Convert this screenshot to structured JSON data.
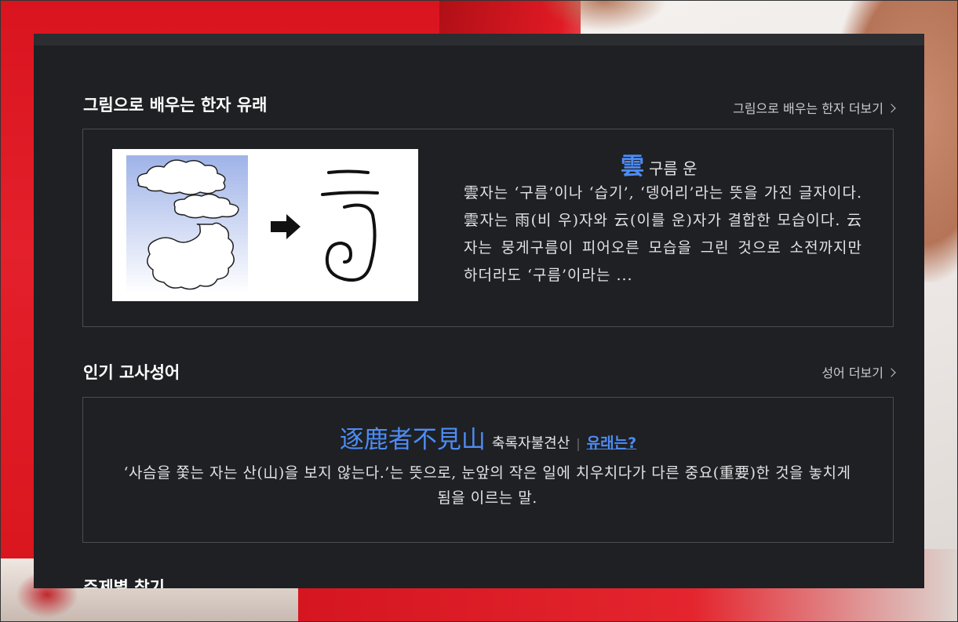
{
  "hanja_story": {
    "section_title": "그림으로 배우는 한자 유래",
    "more_label": "그림으로 배우는 한자 더보기",
    "hanja": "雲",
    "reading": "구름 운",
    "description": "雲자는 ‘구름’이나 ‘습기’, ‘뎅어리’라는 뜻을 가진 글자이다. 雲자는 雨(비 우)자와 云(이를 운)자가 결합한 모습이다. 云자는 뭉게구름이 피어오른 모습을 그린 것으로 소전까지만 하더라도 ‘구름’이라는 ..."
  },
  "idiom": {
    "section_title": "인기 고사성어",
    "more_label": "성어 더보기",
    "hanja": "逐鹿者不見山",
    "reading": "축록자불견산",
    "separator": "|",
    "origin_link": "유래는?",
    "description": "‘사슴을 쫓는 자는 산(山)을 보지 않는다.’는 뜻으로, 눈앞의 작은 일에 치우치다가 다른 중요(重要)한 것을 놓치게 됨을 이르는 말."
  },
  "topic": {
    "section_title": "주제별 찾기"
  },
  "colors": {
    "panel_bg": "#1e2023",
    "accent": "#4d8cf5"
  }
}
